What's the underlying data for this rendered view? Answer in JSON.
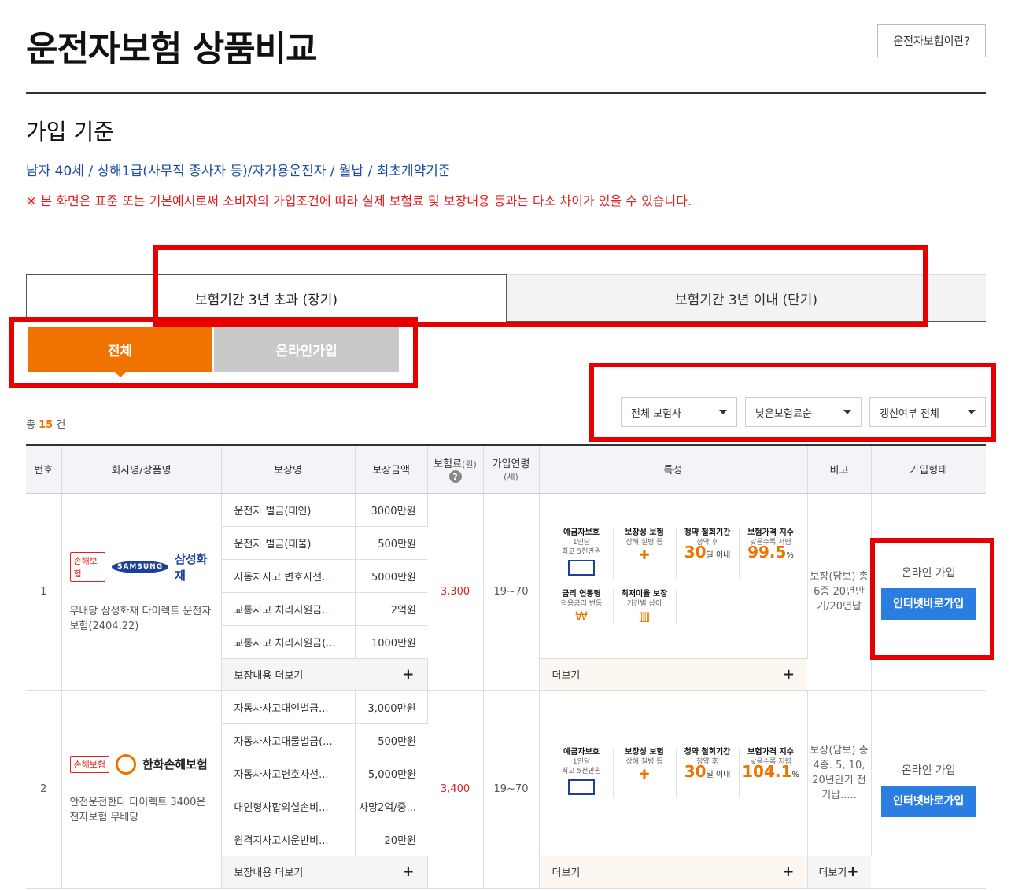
{
  "header": {
    "title": "운전자보험 상품비교",
    "about_button": "운전자보험이란?"
  },
  "criteria": {
    "title": "가입 기준",
    "summary": "남자 40세 / 상해1급(사무직 종사자 등)/자가용운전자 / 월납 / 최초계약기준",
    "notice": "※ 본 화면은 표준 또는 기본예시로써 소비자의 가입조건에 따라 실제 보험료 및 보장내용 등과는 다소 차이가 있을 수 있습니다."
  },
  "tabs": [
    {
      "label": "보험기간 3년 초과 (장기)",
      "active": true
    },
    {
      "label": "보험기간 3년 이내 (단기)",
      "active": false
    }
  ],
  "filters": {
    "all": "전체",
    "online": "온라인가입"
  },
  "count": {
    "prefix": "총",
    "value": "15",
    "suffix": "건"
  },
  "selects": {
    "insurer": "전체 보험사",
    "sort": "낮은보험료순",
    "renewal": "갱신여부 전체"
  },
  "table": {
    "headers": {
      "no": "번호",
      "company": "회사명/상품명",
      "coverage": "보장명",
      "amount": "보장금액",
      "premium": "보험료",
      "premium_unit": "(원)",
      "age": "가입연령",
      "age_unit": "(세)",
      "features": "특성",
      "remark": "비고",
      "join": "가입형태"
    },
    "coverage_more": "보장내용 더보기",
    "feature_more": "더보기",
    "rows": [
      {
        "no": "1",
        "tag": "손해보험",
        "logo_text": "SAMSUNG",
        "company": "삼성화재",
        "product": "무배당 삼성화재 다이렉트 운전자보험(2404.22)",
        "coverages": [
          {
            "name": "운전자 벌금(대인)",
            "amount": "3000만원"
          },
          {
            "name": "운전자 벌금(대물)",
            "amount": "500만원"
          },
          {
            "name": "자동차사고 변호사선...",
            "amount": "5000만원"
          },
          {
            "name": "교통사고 처리지원금...",
            "amount": "2억원"
          },
          {
            "name": "교통사고 처리지원금(...",
            "amount": "1000만원"
          }
        ],
        "premium": "3,300",
        "age": "19~70",
        "features": {
          "deposit_title": "예금자보호",
          "deposit_sub1": "1인당",
          "deposit_sub2": "최고 5천만원",
          "cov_title": "보장성 보험",
          "cov_sub": "상해,질병 등",
          "withdraw_title": "청약 철회기간",
          "withdraw_sub": "청약 후",
          "withdraw_value": "30",
          "withdraw_unit": "일 이내",
          "price_title": "보험가격 지수",
          "price_sub": "낮을수록 저렴",
          "price_value": "99.5",
          "price_unit": "%",
          "rate_title": "금리 연동형",
          "rate_sub": "적용금리 변동",
          "min_title": "최저이율 보장",
          "min_sub": "기간별 상이"
        },
        "remark": "보장(담보) 총 6종 20년만기/20년납",
        "join_label": "온라인 가입",
        "join_button": "인터넷바로가입"
      },
      {
        "no": "2",
        "tag": "손해보험",
        "company": "한화손해보험",
        "product": "안전운전한다 다이렉트 3400운전자보험 무배당",
        "coverages": [
          {
            "name": "자동차사고대인벌금...",
            "amount": "3,000만원"
          },
          {
            "name": "자동차사고대물벌금(...",
            "amount": "500만원"
          },
          {
            "name": "자동차사고변호사선...",
            "amount": "5,000만원"
          },
          {
            "name": "대인형사합의실손비...",
            "amount": "사망2억/중..."
          },
          {
            "name": "원격지사고시운반비...",
            "amount": "20만원"
          }
        ],
        "premium": "3,400",
        "age": "19~70",
        "features": {
          "deposit_title": "예금자보호",
          "deposit_sub1": "1인당",
          "deposit_sub2": "최고 5천만원",
          "cov_title": "보장성 보험",
          "cov_sub": "상해,질병 등",
          "withdraw_title": "청약 철회기간",
          "withdraw_sub": "청약 후",
          "withdraw_value": "30",
          "withdraw_unit": "일 이내",
          "price_title": "보험가격 지수",
          "price_sub": "낮을수록 저렴",
          "price_value": "104.1",
          "price_unit": "%"
        },
        "remark": "보장(담보) 총 4종. 5, 10, 20년만기 전기납.....",
        "remark_more": "더보기",
        "join_label": "온라인 가입",
        "join_button": "인터넷바로가입"
      }
    ]
  },
  "colors": {
    "accent": "#f07300",
    "highlight": "#e80000",
    "join_button": "#2a7de1",
    "criteria_text": "#1a4da3"
  }
}
